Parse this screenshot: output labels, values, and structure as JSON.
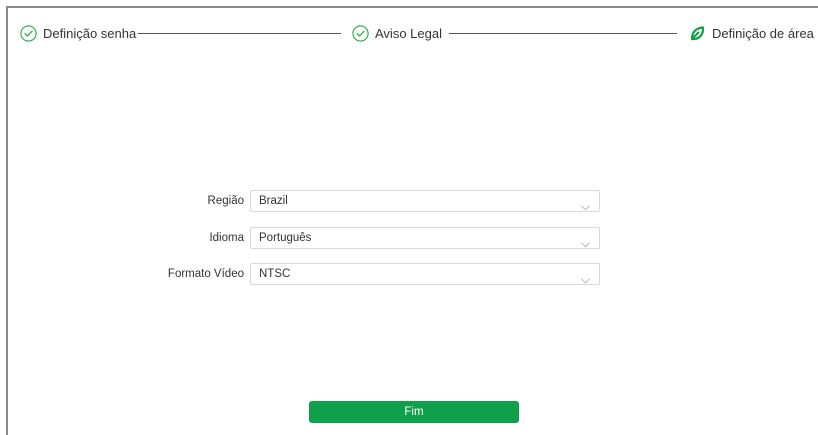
{
  "steps": [
    {
      "label": "Definição senha",
      "icon": "check-circle-icon",
      "state": "done"
    },
    {
      "label": "Aviso Legal",
      "icon": "check-circle-icon",
      "state": "done"
    },
    {
      "label": "Definição de área",
      "icon": "leaf-icon",
      "state": "active"
    }
  ],
  "form": {
    "region": {
      "label": "Região",
      "value": "Brazil"
    },
    "language": {
      "label": "Idioma",
      "value": "Português"
    },
    "video_format": {
      "label": "Formato Vídeo",
      "value": "NTSC"
    }
  },
  "finish_button": {
    "label": "Fim"
  },
  "colors": {
    "accent": "#0ea04a",
    "done_icon": "#27a845",
    "border": "#d9d9d9",
    "frame": "#8a8a8a"
  }
}
